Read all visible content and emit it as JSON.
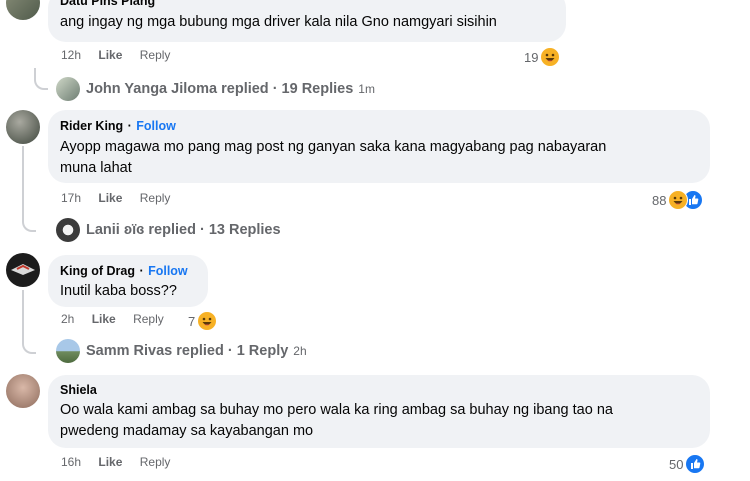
{
  "comments": [
    {
      "author": "Datu Pins Plang",
      "text_lines": [
        "ang ingay ng mga bubung mga driver kala nila Gno namgyari sisihin"
      ],
      "time": "12h",
      "like_label": "Like",
      "reply_label": "Reply",
      "reaction_count": "19",
      "replied": {
        "name": "John Yanga Jiloma",
        "text": "replied · 19 Replies",
        "time": "1m"
      }
    },
    {
      "author": "Rider King",
      "follow": "Follow",
      "separator": "·",
      "text_lines": [
        "Ayopp magawa mo pang mag post ng ganyan saka kana magyabang pag nabayaran",
        "muna lahat"
      ],
      "time": "17h",
      "like_label": "Like",
      "reply_label": "Reply",
      "reaction_count": "88",
      "replied": {
        "name": "Lanii ʚïɞ",
        "text": "replied · 13 Replies",
        "time": ""
      }
    },
    {
      "author": "King of Drag",
      "follow": "Follow",
      "separator": "·",
      "text_lines": [
        "Inutil kaba boss??"
      ],
      "time": "2h",
      "like_label": "Like",
      "reply_label": "Reply",
      "reaction_count": "7",
      "replied": {
        "name": "Samm Rivas",
        "text": "replied · 1 Reply",
        "time": "2h"
      }
    },
    {
      "author": "Shiela",
      "text_lines": [
        "Oo wala kami ambag sa buhay mo pero wala ka ring ambag sa buhay ng ibang tao na",
        "pwedeng madamay sa kayabangan mo"
      ],
      "time": "16h",
      "like_label": "Like",
      "reply_label": "Reply",
      "reaction_count": "50"
    }
  ],
  "colors": {
    "bubble": "#f0f2f5",
    "follow": "#1877f2",
    "meta": "#65676b",
    "haha": "#f7b125",
    "like": "#1877f2"
  },
  "icons": {
    "haha": "haha-reaction-icon",
    "like": "like-reaction-icon"
  }
}
